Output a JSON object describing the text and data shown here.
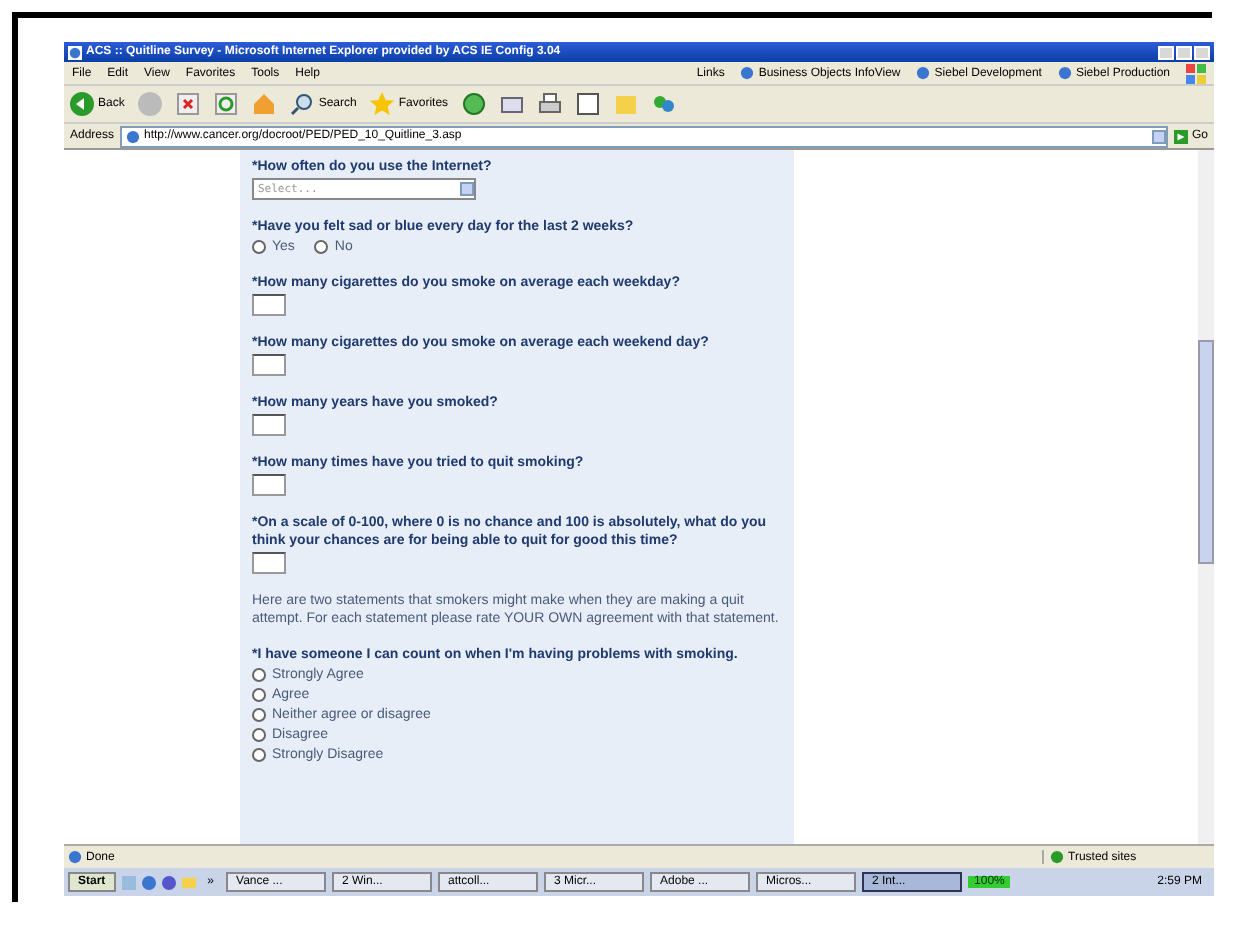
{
  "window": {
    "title": "ACS :: Quitline Survey - Microsoft Internet Explorer provided by ACS IE Config 3.04"
  },
  "menu": [
    "File",
    "Edit",
    "View",
    "Favorites",
    "Tools",
    "Help"
  ],
  "links": {
    "label": "Links",
    "items": [
      "Business Objects InfoView",
      "Siebel Development",
      "Siebel Production"
    ]
  },
  "toolbar": {
    "back": "Back",
    "search": "Search",
    "favorites": "Favorites"
  },
  "address": {
    "label": "Address",
    "value": "http://www.cancer.org/docroot/PED/PED_10_Quitline_3.asp",
    "go": "Go"
  },
  "form": [
    {
      "kind": "select",
      "question": "*How often do you use the Internet?",
      "placeholder": "Select..."
    },
    {
      "kind": "radio",
      "question": "*Have you felt sad or blue every day for the last 2 weeks?",
      "inline": true,
      "options": [
        {
          "label": "Yes",
          "selected": false
        },
        {
          "label": "No",
          "selected": false
        }
      ]
    },
    {
      "kind": "text",
      "question": "*How many cigarettes do you smoke on average each weekday?"
    },
    {
      "kind": "text",
      "question": "*How many cigarettes do you smoke on average each weekend day?"
    },
    {
      "kind": "text",
      "question": "*How many years have you smoked?"
    },
    {
      "kind": "text",
      "question": "*How many times have you tried to quit smoking?"
    },
    {
      "kind": "text",
      "question": "*On a scale of 0-100, where 0 is no chance and 100 is absolutely, what do you think your chances are for being able to quit for good this time?"
    },
    {
      "kind": "note",
      "text": "Here are two statements that smokers might make when they are making a quit attempt. For each statement please rate YOUR OWN agreement with that statement."
    },
    {
      "kind": "radio",
      "question": "*I have someone I can count on when I'm having problems with smoking.",
      "inline": false,
      "options": [
        {
          "label": "Strongly Agree",
          "selected": false
        },
        {
          "label": "Agree",
          "selected": false
        },
        {
          "label": "Neither agree or disagree",
          "selected": false
        },
        {
          "label": "Disagree",
          "selected": false
        },
        {
          "label": "Strongly Disagree",
          "selected": false
        }
      ]
    }
  ],
  "status_bar": {
    "text": "Done",
    "zone": "Trusted sites"
  },
  "taskbar": {
    "start": "Start",
    "more": "»",
    "items": [
      {
        "label": "Vance ...",
        "selected": false
      },
      {
        "label": "2 Win...",
        "selected": false
      },
      {
        "label": "attcoll...",
        "selected": false
      },
      {
        "label": "3 Micr...",
        "selected": false
      },
      {
        "label": "Adobe ...",
        "selected": false
      },
      {
        "label": "Micros...",
        "selected": false
      },
      {
        "label": "2 Int...",
        "selected": true
      }
    ],
    "zoom": "100%",
    "clock": "2:59 PM"
  }
}
